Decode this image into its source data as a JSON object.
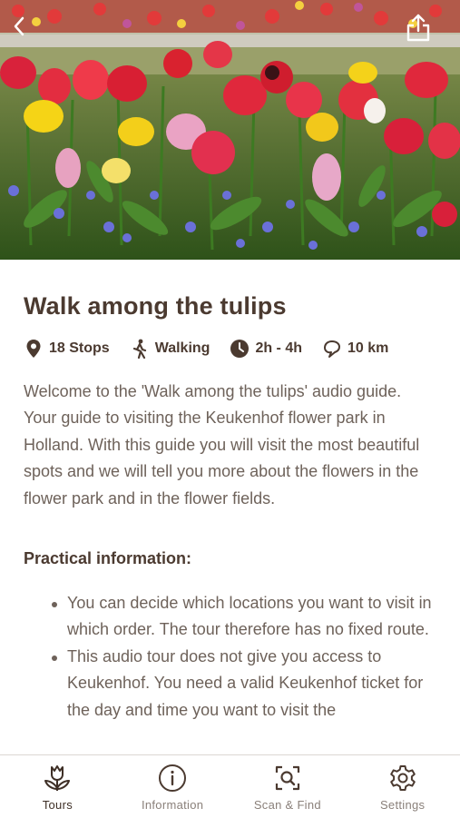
{
  "hero": {
    "image_name": "tulip-flower-bed-photo",
    "back_icon": "chevron-left-icon",
    "share_icon": "share-icon"
  },
  "tour": {
    "title": "Walk among the tulips",
    "meta": [
      {
        "icon": "location-pin-icon",
        "label": "18 Stops"
      },
      {
        "icon": "walking-person-icon",
        "label": "Walking"
      },
      {
        "icon": "clock-icon",
        "label": "2h - 4h"
      },
      {
        "icon": "route-icon",
        "label": "10 km"
      }
    ],
    "description": "Welcome to the 'Walk among the tulips' audio guide. Your guide to visiting the Keukenhof flower park in Holland. With this guide you will visit the most beautiful spots and we will tell you more about the flowers in the flower park and in the flower fields.",
    "practical_heading": "Practical information:",
    "practical_items": [
      "You can decide which locations you want to visit in which order. The tour therefore has no fixed route.",
      "This audio tour does not give you access to Keukenhof. You need a valid Keukenhof ticket for the day and time you want to visit the"
    ]
  },
  "tabs": [
    {
      "icon": "tulip-icon",
      "label": "Tours",
      "active": true
    },
    {
      "icon": "info-icon",
      "label": "Information",
      "active": false
    },
    {
      "icon": "scan-icon",
      "label": "Scan & Find",
      "active": false
    },
    {
      "icon": "gear-icon",
      "label": "Settings",
      "active": false
    }
  ],
  "colors": {
    "title": "#4b3a30",
    "body_text": "#6e625a",
    "tab_inactive": "#8a807a",
    "tab_active": "#3e2f26"
  }
}
